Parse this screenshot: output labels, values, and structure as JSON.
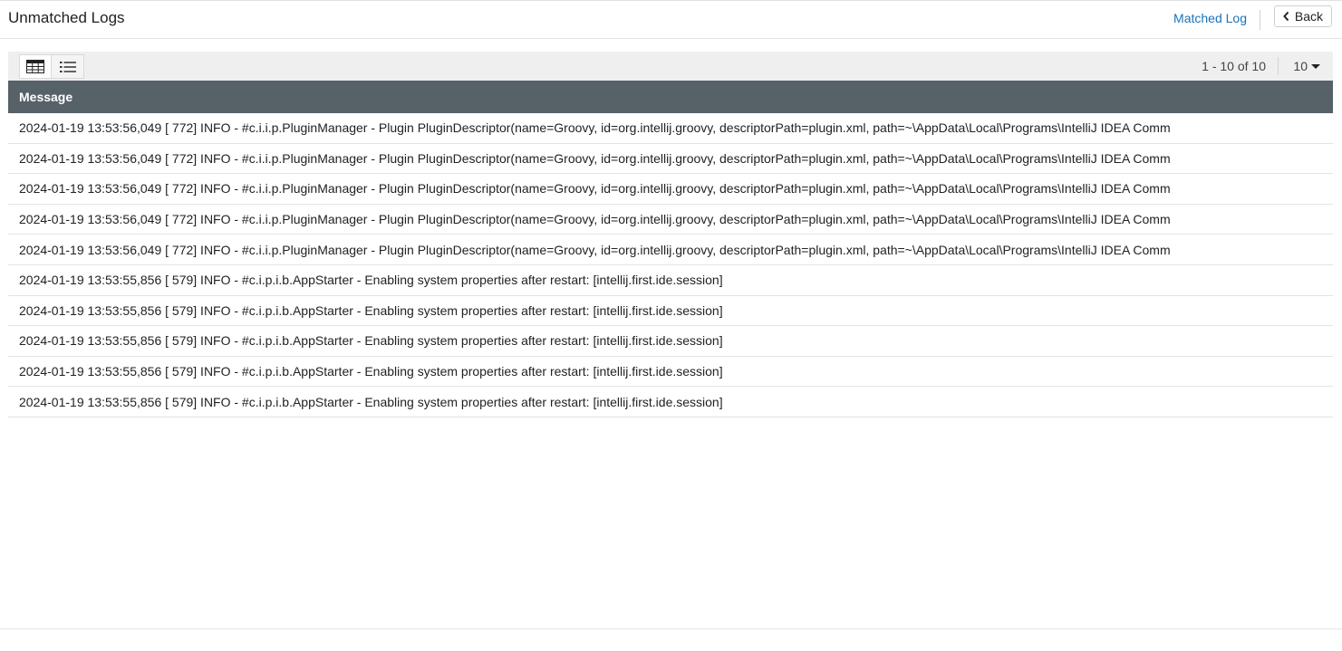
{
  "header": {
    "title": "Unmatched Logs",
    "matched_link": "Matched Log",
    "back_label": "Back"
  },
  "toolbar": {
    "views": [
      {
        "icon": "table-view-icon",
        "active": true
      },
      {
        "icon": "list-view-icon",
        "active": false
      }
    ],
    "pager_text": "1 - 10 of 10",
    "page_size": "10"
  },
  "table": {
    "columns": [
      "Message"
    ],
    "rows": [
      "2024-01-19 13:53:56,049 [ 772] INFO - #c.i.i.p.PluginManager - Plugin PluginDescriptor(name=Groovy, id=org.intellij.groovy, descriptorPath=plugin.xml, path=~\\AppData\\Local\\Programs\\IntelliJ IDEA Comm",
      "2024-01-19 13:53:56,049 [ 772] INFO - #c.i.i.p.PluginManager - Plugin PluginDescriptor(name=Groovy, id=org.intellij.groovy, descriptorPath=plugin.xml, path=~\\AppData\\Local\\Programs\\IntelliJ IDEA Comm",
      "2024-01-19 13:53:56,049 [ 772] INFO - #c.i.i.p.PluginManager - Plugin PluginDescriptor(name=Groovy, id=org.intellij.groovy, descriptorPath=plugin.xml, path=~\\AppData\\Local\\Programs\\IntelliJ IDEA Comm",
      "2024-01-19 13:53:56,049 [ 772] INFO - #c.i.i.p.PluginManager - Plugin PluginDescriptor(name=Groovy, id=org.intellij.groovy, descriptorPath=plugin.xml, path=~\\AppData\\Local\\Programs\\IntelliJ IDEA Comm",
      "2024-01-19 13:53:56,049 [ 772] INFO - #c.i.i.p.PluginManager - Plugin PluginDescriptor(name=Groovy, id=org.intellij.groovy, descriptorPath=plugin.xml, path=~\\AppData\\Local\\Programs\\IntelliJ IDEA Comm",
      "2024-01-19 13:53:55,856 [ 579] INFO - #c.i.p.i.b.AppStarter - Enabling system properties after restart: [intellij.first.ide.session]",
      "2024-01-19 13:53:55,856 [ 579] INFO - #c.i.p.i.b.AppStarter - Enabling system properties after restart: [intellij.first.ide.session]",
      "2024-01-19 13:53:55,856 [ 579] INFO - #c.i.p.i.b.AppStarter - Enabling system properties after restart: [intellij.first.ide.session]",
      "2024-01-19 13:53:55,856 [ 579] INFO - #c.i.p.i.b.AppStarter - Enabling system properties after restart: [intellij.first.ide.session]",
      "2024-01-19 13:53:55,856 [ 579] INFO - #c.i.p.i.b.AppStarter - Enabling system properties after restart: [intellij.first.ide.session]"
    ]
  },
  "colors": {
    "link": "#1a73b8",
    "table_header_bg": "#566168",
    "toolbar_bg": "#efefef"
  }
}
